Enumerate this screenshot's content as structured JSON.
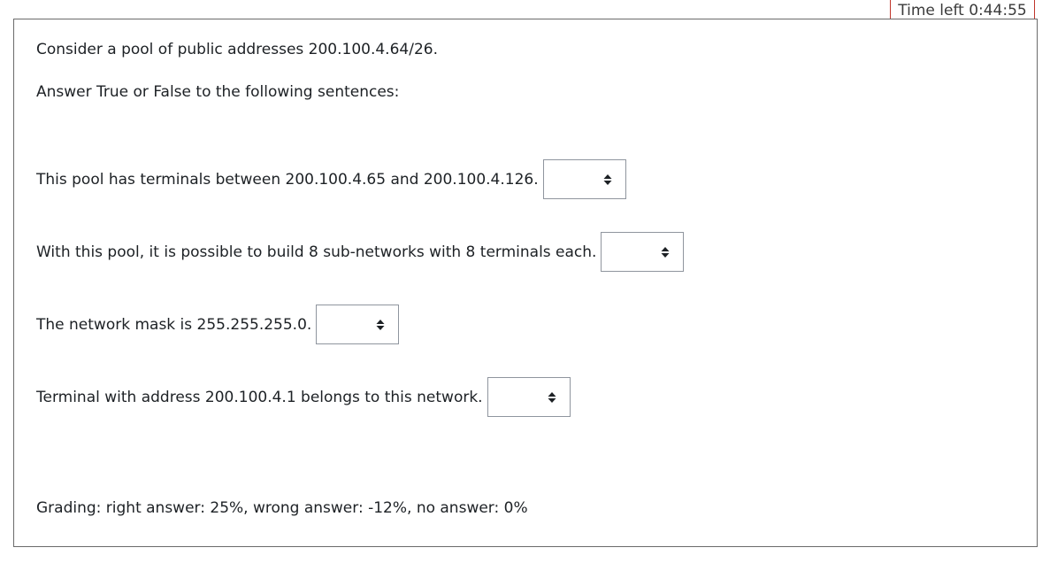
{
  "timer": {
    "label": "Time left 0:44:55"
  },
  "question": {
    "intro": "Consider a pool of public addresses 200.100.4.64/26.",
    "instruction": "Answer True or False to the following sentences:",
    "statements": [
      {
        "text": "This pool has terminals between 200.100.4.65 and 200.100.4.126.",
        "selected": ""
      },
      {
        "text": "With this pool, it is possible to build 8 sub-networks with 8 terminals each.",
        "selected": ""
      },
      {
        "text": "The network mask is 255.255.255.0.",
        "selected": ""
      },
      {
        "text": "Terminal with address 200.100.4.1 belongs to this network.",
        "selected": ""
      }
    ],
    "grading": "Grading: right answer: 25%, wrong answer: -12%, no answer: 0%"
  },
  "icons": {
    "select_arrow": "updown-caret-icon"
  },
  "colors": {
    "timer_border": "#c0352b",
    "box_border": "#6b6b6b",
    "select_border": "#8f959e",
    "text": "#1d2125"
  }
}
